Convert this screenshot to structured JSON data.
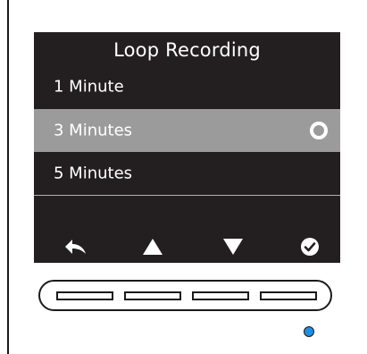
{
  "menu": {
    "title": "Loop Recording",
    "options": [
      {
        "label": "1 Minute",
        "selected": false
      },
      {
        "label": "3 Minutes",
        "selected": true
      },
      {
        "label": "5 Minutes",
        "selected": false
      }
    ]
  },
  "controls": [
    {
      "icon": "back-arrow-icon"
    },
    {
      "icon": "up-triangle-icon"
    },
    {
      "icon": "down-triangle-icon"
    },
    {
      "icon": "confirm-check-icon"
    }
  ],
  "colors": {
    "screen_bg": "#231f20",
    "highlight": "#9b9b9b",
    "text": "#ffffff",
    "led": "#1f8fe0"
  }
}
